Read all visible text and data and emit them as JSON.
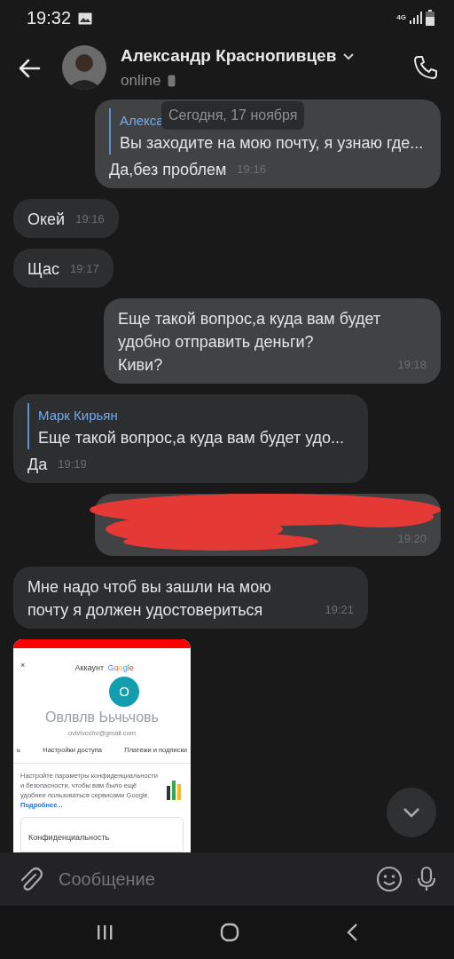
{
  "status_bar": {
    "time": "19:32",
    "network": "4G"
  },
  "header": {
    "name": "Александр Краснопивцев",
    "status": "online"
  },
  "date_pill": "Сегодня, 17 ноября",
  "messages": [
    {
      "kind": "text",
      "outgoing": true,
      "quote": {
        "author": "Алекса",
        "text": "Вы заходите на мою почту, я узнаю где..."
      },
      "text": "Да,без проблем",
      "time": "19:16"
    },
    {
      "kind": "text",
      "outgoing": false,
      "text": "Окей",
      "time": "19:16"
    },
    {
      "kind": "text",
      "outgoing": false,
      "text": "Щас",
      "time": "19:17"
    },
    {
      "kind": "text",
      "outgoing": true,
      "text": "Еще такой вопрос,а куда вам будет удобно отправить деньги?\nКиви?",
      "time": "19:18"
    },
    {
      "kind": "text",
      "outgoing": false,
      "quote": {
        "author": "Марк Кирьян",
        "text": "Еще такой вопрос,а куда вам будет удо..."
      },
      "text": "Да",
      "time": "19:19"
    },
    {
      "kind": "redacted",
      "outgoing": true,
      "time": "19:20"
    },
    {
      "kind": "text",
      "outgoing": false,
      "text": "Мне надо чтоб вы зашли на мою почту я должен удостовериться",
      "time": "19:21"
    },
    {
      "kind": "screenshot",
      "outgoing": false,
      "screenshot": {
        "close": "×",
        "title": "Аккаунт",
        "brand": "Google",
        "avatar_letter": "О",
        "account_name": "Овлвлв Ььчьчовь",
        "email": "ovlvlvcchv@gmail.com",
        "tabs": [
          "ь",
          "Настройки доступа",
          "Платежи и подписки"
        ],
        "notice": "Настройте параметры конфиденциальности и безопасности, чтобы вам было ещё удобнее пользоваться сервисами Google.",
        "notice_link": "Подробнее...",
        "card_title": "Конфиденциальность"
      }
    }
  ],
  "composer": {
    "placeholder": "Сообщение"
  }
}
